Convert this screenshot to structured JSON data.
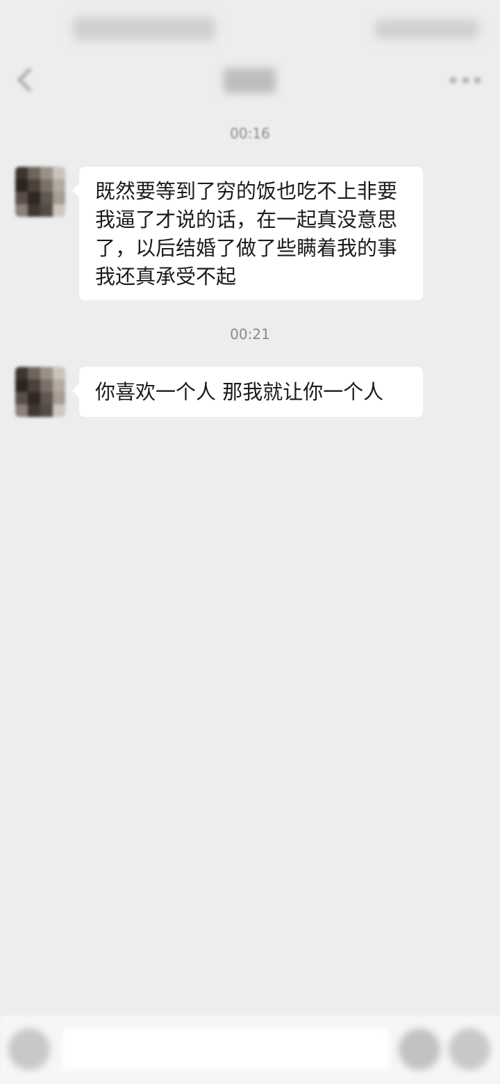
{
  "status_bar": {
    "left_text": "",
    "right_text": ""
  },
  "header": {
    "title": ""
  },
  "messages": [
    {
      "timestamp": "00:16",
      "text": "既然要等到了穷的饭也吃不上非要我逼了才说的话，在一起真没意思了，以后结婚了做了些瞒着我的事我还真承受不起"
    },
    {
      "timestamp": "00:21",
      "text": "你喜欢一个人 那我就让你一个人"
    }
  ],
  "colors": {
    "background": "#ededed",
    "bubble": "#ffffff",
    "timestamp": "#8a8a8a"
  },
  "icons": {
    "back": "back-arrow-icon",
    "more": "more-dots-icon",
    "voice": "voice-icon",
    "emoji": "emoji-icon",
    "plus": "plus-icon"
  }
}
